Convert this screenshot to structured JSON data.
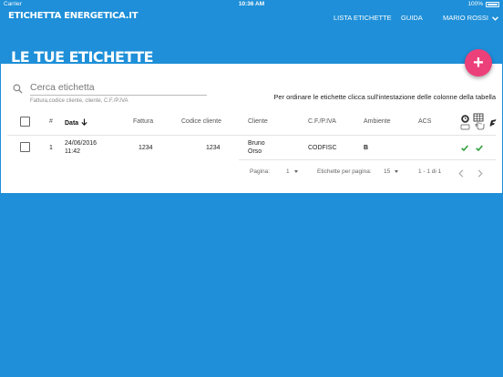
{
  "status_bar": {
    "carrier": "Carrier",
    "time": "10:36 AM",
    "battery": "100%"
  },
  "nav": {
    "brand": "ETICHETTA ENERGETICA.IT",
    "links": [
      "LISTA ETICHETTE",
      "GUIDA"
    ],
    "user": "MARIO ROSSI"
  },
  "page": {
    "title": "LE TUE ETICHETTE",
    "fab_label": "+"
  },
  "search": {
    "placeholder": "Cerca etichetta",
    "hint": "Fattura,codice cliente, cliente, C.F./P.IVA"
  },
  "sort_hint": "Per ordinare le etichette clicca sull'intestazione delle colonne della tabella",
  "table": {
    "headers": {
      "num": "#",
      "date": "Data",
      "invoice": "Fattura",
      "client_code": "Codice cliente",
      "client": "Cliente",
      "cf_piva": "C.F./P.IVA",
      "ambiente": "Ambiente",
      "acs": "ACS"
    },
    "icons": [
      "clock-badge-icon",
      "grid-touch-icon",
      "edit-icon"
    ],
    "rows": [
      {
        "num": "1",
        "date": "24/06/2016",
        "time": "11:42",
        "invoice": "1234",
        "client_code": "1234",
        "client_first": "Bruno",
        "client_last": "Orso",
        "cf_piva": "CODFISC",
        "ambiente": "B",
        "acs": ""
      }
    ]
  },
  "pagination": {
    "page_label": "Pagina:",
    "page_value": "1",
    "per_page_label": "Etichette per pagina:",
    "per_page_value": "15",
    "range": "1 - 1 di 1"
  },
  "colors": {
    "primary": "#1e8fd8",
    "accent": "#ec407a",
    "check": "#2e9e3c"
  }
}
